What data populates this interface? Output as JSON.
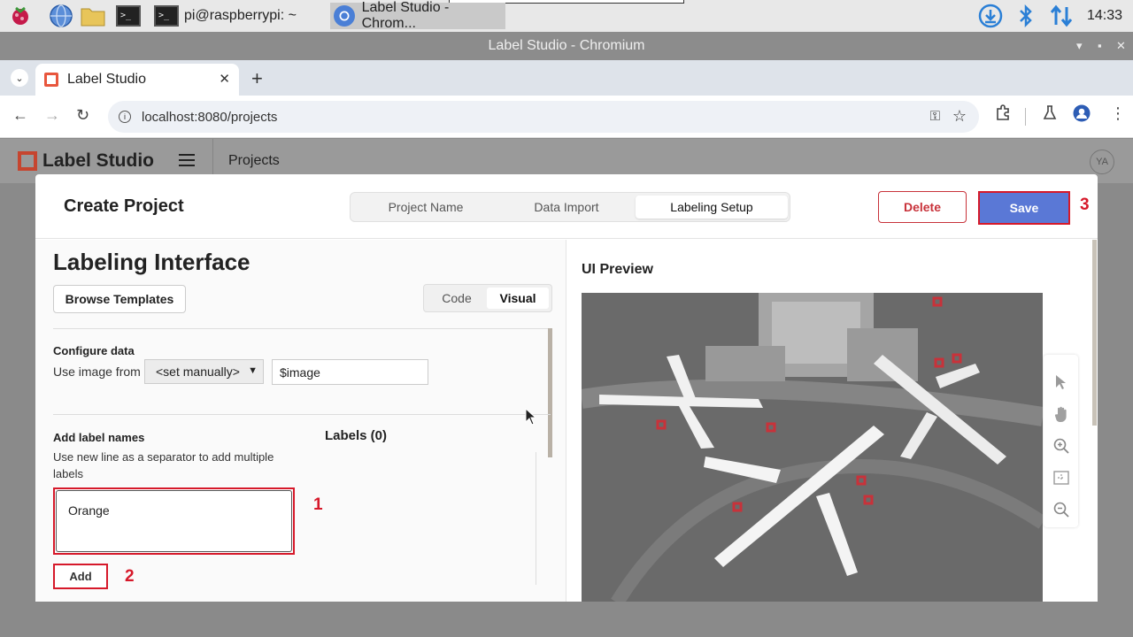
{
  "taskbar": {
    "tasks": [
      {
        "label": "pi@raspberrypi: ~"
      },
      {
        "label": "Label Studio - Chrom..."
      }
    ],
    "clock": "14:33"
  },
  "browser": {
    "window_title": "Label Studio - Chromium",
    "tab_title": "Label Studio",
    "url": "localhost:8080/projects"
  },
  "app": {
    "logo_text": "Label Studio",
    "breadcrumb": "Projects",
    "avatar_initials": "YA"
  },
  "modal": {
    "title": "Create Project",
    "steps": [
      {
        "label": "Project Name",
        "active": false
      },
      {
        "label": "Data Import",
        "active": false
      },
      {
        "label": "Labeling Setup",
        "active": true
      }
    ],
    "delete_label": "Delete",
    "save_label": "Save"
  },
  "labeling": {
    "heading": "Labeling Interface",
    "browse_label": "Browse Templates",
    "toggle": {
      "code": "Code",
      "visual": "Visual",
      "selected": "Visual"
    },
    "configure_data": {
      "title": "Configure data",
      "use_image_from": "Use image from",
      "select_value": "<set manually>",
      "input_value": "$image"
    },
    "add_labels": {
      "title": "Add label names",
      "hint": "Use new line as a separator to add multiple labels",
      "textarea_value": "Orange",
      "add_label": "Add",
      "labels_heading": "Labels (0)"
    }
  },
  "preview": {
    "heading": "UI Preview"
  },
  "annotations": {
    "one": "1",
    "two": "2",
    "three": "3"
  },
  "colors": {
    "accent": "#5a78d6",
    "danger": "#c8323a",
    "callout": "#d6192a",
    "brand": "#e8563d"
  }
}
